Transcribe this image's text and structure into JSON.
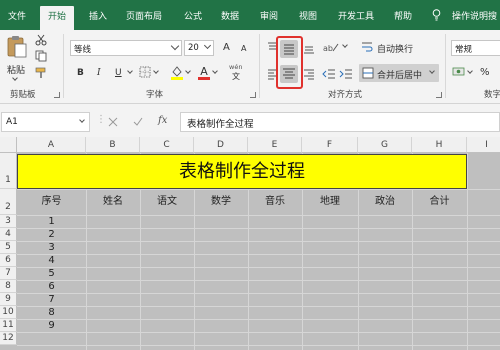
{
  "ribbon_tabs": [
    "文件",
    "开始",
    "插入",
    "页面布局",
    "公式",
    "数据",
    "审阅",
    "视图",
    "开发工具",
    "帮助"
  ],
  "active_tab": "开始",
  "tell_me": "操作说明搜",
  "clipboard": {
    "paste_label": "粘贴",
    "group_label": "剪贴板"
  },
  "font": {
    "name": "等线",
    "size": "20",
    "grow": "A",
    "shrink": "A",
    "bold": "B",
    "italic": "I",
    "underline": "U",
    "wen": "wén",
    "group_label": "字体"
  },
  "alignment": {
    "wrap_text": "自动换行",
    "merge_center": "合并后居中",
    "group_label": "对齐方式"
  },
  "number": {
    "format": "常规",
    "percent": "%",
    "group_label": "数字"
  },
  "formula_bar": {
    "name_box": "A1",
    "fx_label": "fx",
    "content": "表格制作全过程"
  },
  "colors": {
    "excel_green": "#217346",
    "title_fill": "#ffff00",
    "highlight_box": "#e0312d",
    "cell_fill": "#bfbfbf"
  },
  "sheet": {
    "columns": [
      "A",
      "B",
      "C",
      "D",
      "E",
      "F",
      "G",
      "H",
      "I"
    ],
    "rows": [
      "1",
      "2",
      "3",
      "4",
      "5",
      "6",
      "7",
      "8",
      "9",
      "10",
      "11",
      "12"
    ],
    "title": "表格制作全过程",
    "headers": [
      "序号",
      "姓名",
      "语文",
      "数学",
      "音乐",
      "地理",
      "政治",
      "合计"
    ],
    "serials": [
      "1",
      "2",
      "3",
      "4",
      "5",
      "6",
      "7",
      "8",
      "9"
    ]
  }
}
